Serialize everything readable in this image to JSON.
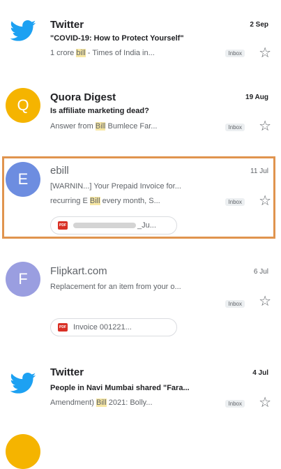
{
  "colors": {
    "twitter": "#1da1f2",
    "quora": "#f5b400",
    "ebill": "#6d8de0",
    "flipkart": "#9a9ee0",
    "highlight_border": "#e0944e"
  },
  "emails": [
    {
      "sender": "Twitter",
      "date": "2 Sep",
      "subject": "\"COVID-19: How to Protect Yourself\"",
      "snippet_pre": "1 crore ",
      "snippet_hl": "bill",
      "snippet_post": " - Times of India in...",
      "label": "Inbox",
      "icon": "twitter-bird-icon"
    },
    {
      "sender": "Quora Digest",
      "date": "19 Aug",
      "avatar_letter": "Q",
      "subject": "Is affiliate marketing dead?",
      "snippet_pre": "Answer from ",
      "snippet_hl": "Bill",
      "snippet_post": " Bumlece Far...",
      "label": "Inbox"
    },
    {
      "sender": "ebill",
      "date": "11 Jul",
      "avatar_letter": "E",
      "subject": "[WARNIN...] Your Prepaid Invoice for...",
      "snippet_pre": "recurring E ",
      "snippet_hl": "Bill",
      "snippet_post": " every month, S...",
      "label": "Inbox",
      "attachment": "_Ju..."
    },
    {
      "sender": "Flipkart.com",
      "date": "6 Jul",
      "avatar_letter": "F",
      "subject": "Replacement for an item from your o...",
      "label": "Inbox",
      "attachment": "Invoice 001221..."
    },
    {
      "sender": "Twitter",
      "date": "4 Jul",
      "subject": "People in Navi Mumbai shared \"Fara...",
      "snippet_pre": "Amendment) ",
      "snippet_hl": "Bill",
      "snippet_post": " 2021: Bolly...",
      "label": "Inbox",
      "icon": "twitter-bird-icon"
    }
  ]
}
